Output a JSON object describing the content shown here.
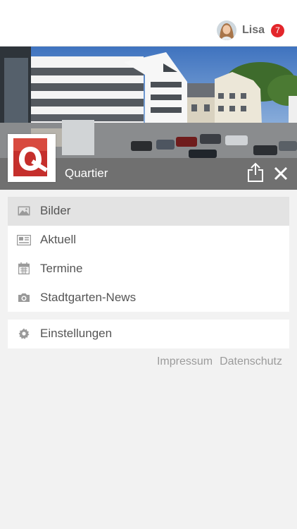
{
  "user": {
    "name": "Lisa",
    "notification_count": "7"
  },
  "header": {
    "title": "Quartier",
    "accent": "#e3262b"
  },
  "menu": {
    "items": [
      {
        "label": "Bilder",
        "icon": "image-icon",
        "active": true
      },
      {
        "label": "Aktuell",
        "icon": "newspaper-icon"
      },
      {
        "label": "Termine",
        "icon": "calendar-icon"
      },
      {
        "label": "Stadtgarten-News",
        "icon": "camera-icon"
      }
    ],
    "settings": {
      "label": "Einstellungen",
      "icon": "gear-icon"
    }
  },
  "footer": {
    "impressum": "Impressum",
    "datenschutz": "Datenschutz"
  }
}
